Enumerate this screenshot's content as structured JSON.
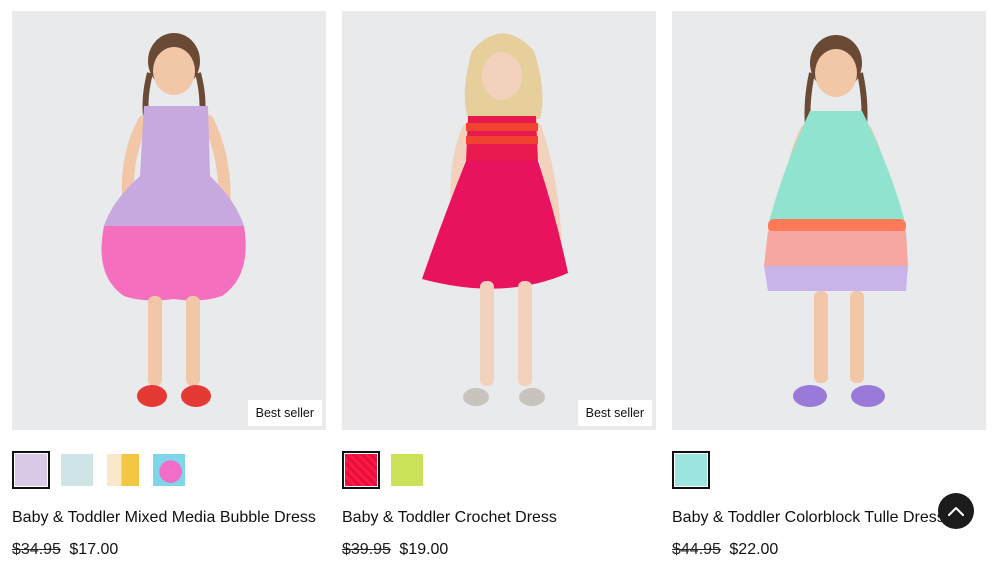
{
  "products": [
    {
      "name": "Baby & Toddler Mixed Media Bubble Dress",
      "badge": "Best seller",
      "price_original": "$34.95",
      "price_sale": "$17.00",
      "swatches": [
        {
          "color": "#d8c9e6",
          "selected": true
        },
        {
          "color": "#cfe4e6",
          "selected": false
        },
        {
          "color": "#f3c744",
          "selected": false
        },
        {
          "color": "#f26dc5",
          "selected": false
        }
      ]
    },
    {
      "name": "Baby & Toddler Crochet Dress",
      "badge": "Best seller",
      "price_original": "$39.95",
      "price_sale": "$19.00",
      "swatches": [
        {
          "color": "#ff1744",
          "selected": true
        },
        {
          "color": "#c9e25a",
          "selected": false
        }
      ]
    },
    {
      "name": "Baby & Toddler Colorblock Tulle Dress",
      "badge": "",
      "price_original": "$44.95",
      "price_sale": "$22.00",
      "swatches": [
        {
          "color": "#9de6df",
          "selected": true
        }
      ]
    }
  ],
  "colors": {
    "photo_bg": "#e9eaec",
    "back_to_top": "#1c1c1c"
  },
  "back_to_top_icon": "chevron-up-icon"
}
